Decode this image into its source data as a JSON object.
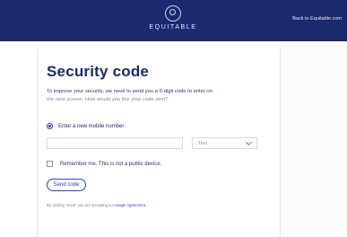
{
  "header": {
    "brand": "EQUITABLE",
    "back_link": "Back to Equitable.com"
  },
  "main": {
    "title": "Security code",
    "description_line1": "To improve your security, we need to send you a 6-digit code to enter on",
    "description_line2": "the next screen. How would you like your code sent?",
    "option_label": "Enter a new mobile number:",
    "phone_value": "",
    "type_select_value": "Text",
    "remember_label": "Remember me. This is not a public device.",
    "send_button": "Send code",
    "legal_prefix": "By clicking \"Send\" you are accepting our ",
    "legal_link": "Usage Agreement",
    "legal_suffix": "."
  },
  "colors": {
    "header_bg": "#1b2a6e",
    "accent": "#2a45b6"
  }
}
